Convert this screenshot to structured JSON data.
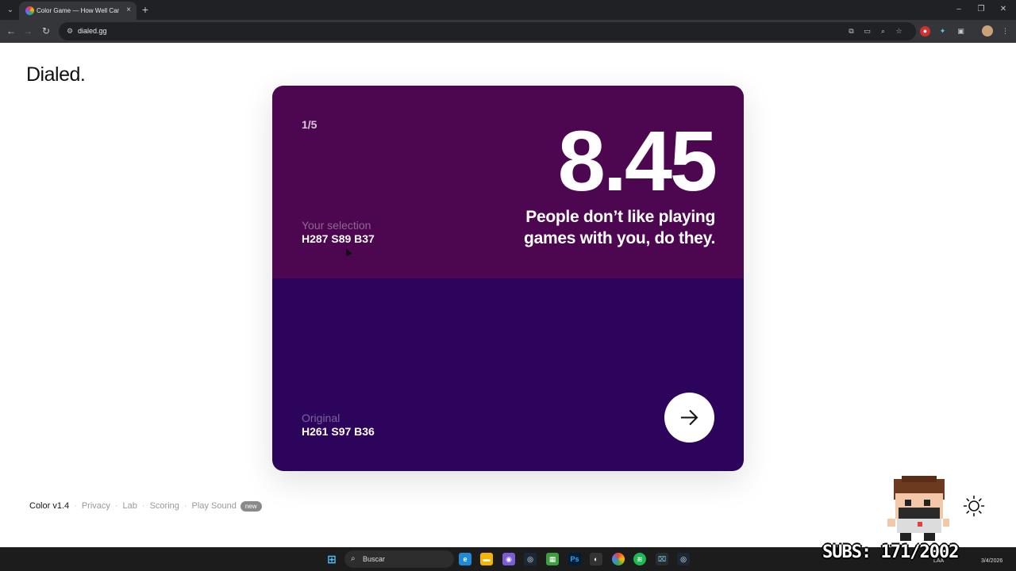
{
  "browser": {
    "tab_title": "Color Game — How Well Can Y",
    "tab_close": "×",
    "new_tab": "+",
    "url": "dialed.gg",
    "window_controls": [
      "–",
      "❐",
      "✕"
    ]
  },
  "page": {
    "logo": "Dialed.",
    "round_counter": "1/5",
    "score": "8.45",
    "verdict": "People don’t like playing games with you, do they.",
    "selection": {
      "label": "Your selection",
      "value": "H287 S89 B37",
      "color": "#4d0650"
    },
    "original": {
      "label": "Original",
      "value": "H261 S97 B36",
      "color": "#2c045c"
    },
    "next_icon": "arrow-right-icon"
  },
  "footer": {
    "version": "Color v1.4",
    "links": [
      "Privacy",
      "Lab",
      "Scoring",
      "Play Sound"
    ],
    "separator": "·",
    "new_badge": "new",
    "theme_icon": "sun-icon"
  },
  "taskbar": {
    "search_placeholder": "Buscar",
    "lang": "LAA",
    "date": "3/4/2026"
  },
  "overlay": {
    "subs": "SUBS: 171/2002"
  }
}
